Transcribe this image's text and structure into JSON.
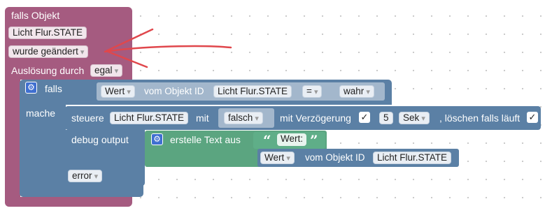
{
  "trigger": {
    "title": "falls Objekt",
    "object_id": "Licht Flur.STATE",
    "condition": "wurde geändert",
    "trigger_by_label": "Auslösung durch",
    "trigger_by_value": "egal"
  },
  "if_block": {
    "label": "falls",
    "do_label": "mache",
    "compare": {
      "value_field": "Wert",
      "from_label": "vom Objekt ID",
      "object_id": "Licht Flur.STATE",
      "operator": "=",
      "rhs": "wahr"
    }
  },
  "control": {
    "label": "steuere",
    "object_id": "Licht Flur.STATE",
    "with_label": "mit",
    "value": "falsch",
    "delay_label": "mit Verzögerung",
    "delay_checked": "✓",
    "delay_value": "5",
    "delay_unit": "Sek",
    "clear_label": ", löschen falls läuft",
    "clear_checked": "✓"
  },
  "debug": {
    "label": "debug output",
    "create_text_label": "erstelle Text aus",
    "text_literal": "Wert:",
    "value_field": "Wert",
    "from_label": "vom Objekt ID",
    "object_id": "Licht Flur.STATE",
    "level": "error"
  },
  "colors": {
    "trigger_block": "#a55b80",
    "logic_block": "#5b80a5",
    "text_block": "#5ba580",
    "annotation_arrow": "#e0474c"
  },
  "icons": [
    "gear-icon",
    "quote-open-icon",
    "quote-close-icon",
    "checkmark-icon",
    "dropdown-arrow-icon"
  ]
}
